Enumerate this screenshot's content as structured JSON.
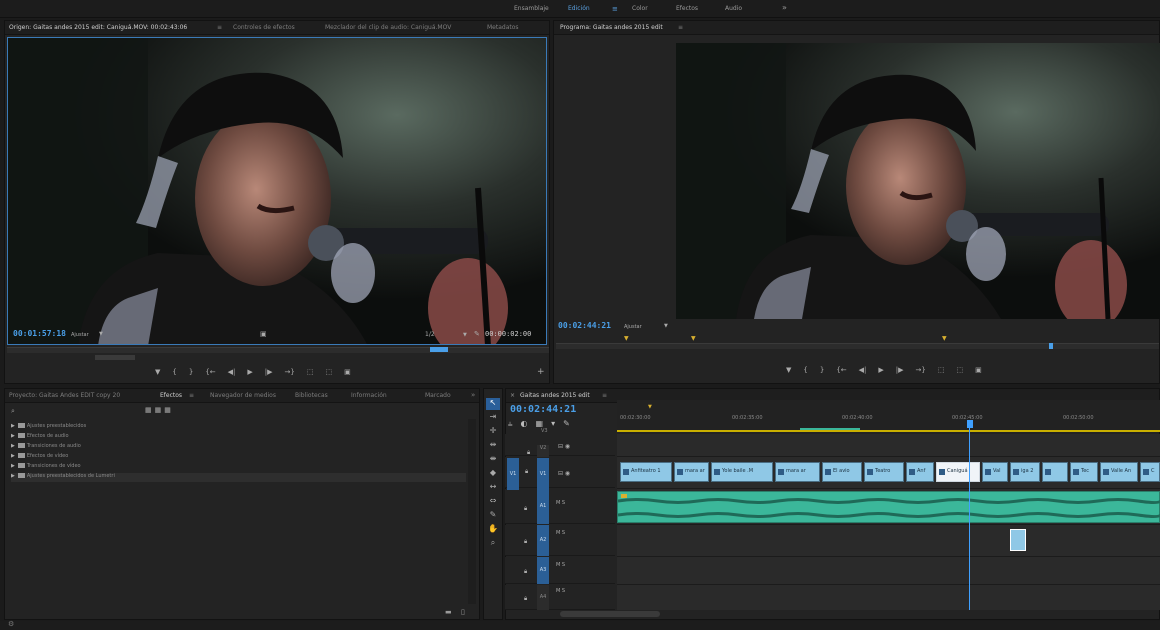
{
  "workspace_bar": {
    "items": [
      "Ensamblaje",
      "Edición",
      "Color",
      "Efectos",
      "Audio",
      "»"
    ],
    "active_index": 1,
    "edicion_menu_icon": "hamburger-icon"
  },
  "source_monitor": {
    "tabs": [
      "Origen: Gaitas andes 2015 edit: Caniguá.MOV: 00:02:43:06",
      "Controles de efectos",
      "Mezclador del clip de audio: Caniguá.MOV",
      "Metadatos"
    ],
    "timecode_current": "00:01:57:18",
    "fit_label": "Ajustar",
    "resolution": "1/2",
    "timecode_duration": "00:00:02:00"
  },
  "program_monitor": {
    "tab": "Programa: Gaitas andes 2015 edit",
    "timecode_current": "00:02:44:21",
    "fit_label": "Ajustar"
  },
  "transport_glyphs": [
    "▼",
    "{",
    "}",
    "{←",
    "◀|",
    "▶",
    "|▶",
    "→}",
    "⬚",
    "⬚",
    "▣"
  ],
  "project_panel": {
    "tabs": [
      "Proyecto: Gaitas Andes EDIT copy 20",
      "Efectos",
      "Navegador de medios",
      "Bibliotecas",
      "Información",
      "Marcado",
      "»"
    ],
    "active_tab_index": 1,
    "tree_items": [
      "Ajustes preestablecidos",
      "Efectos de audio",
      "Transiciones de audio",
      "Efectos de vídeo",
      "Transiciones de vídeo",
      "Ajustes preestablecidos de Lumetri"
    ]
  },
  "timeline": {
    "tab": "Gaitas andes 2015 edit",
    "timecode": "00:02:44:21",
    "ruler_labels": [
      "00:02:30:00",
      "00:02:35:00",
      "00:02:40:00",
      "00:02:45:00",
      "00:02:50:00"
    ],
    "tracks": [
      "V2",
      "V1",
      "A1",
      "A2",
      "A3",
      "A4"
    ],
    "source_patch": {
      "video": "V1",
      "audio": "A1"
    },
    "track_buttons": "M S",
    "clips_v1": [
      "Anfiteatro 1",
      "mara ar",
      "Yole baile .M",
      "mara ar",
      "El avio",
      "Teatro",
      "Anf",
      "Caniguá",
      "Val",
      "iga 2",
      "",
      "Tec",
      "Valle An",
      "C"
    ]
  },
  "colors": {
    "accent_blue": "#4a9fe8",
    "clip_video": "#8fc8e6",
    "clip_audio": "#3bb79a",
    "playhead": "#3fa0ff"
  }
}
